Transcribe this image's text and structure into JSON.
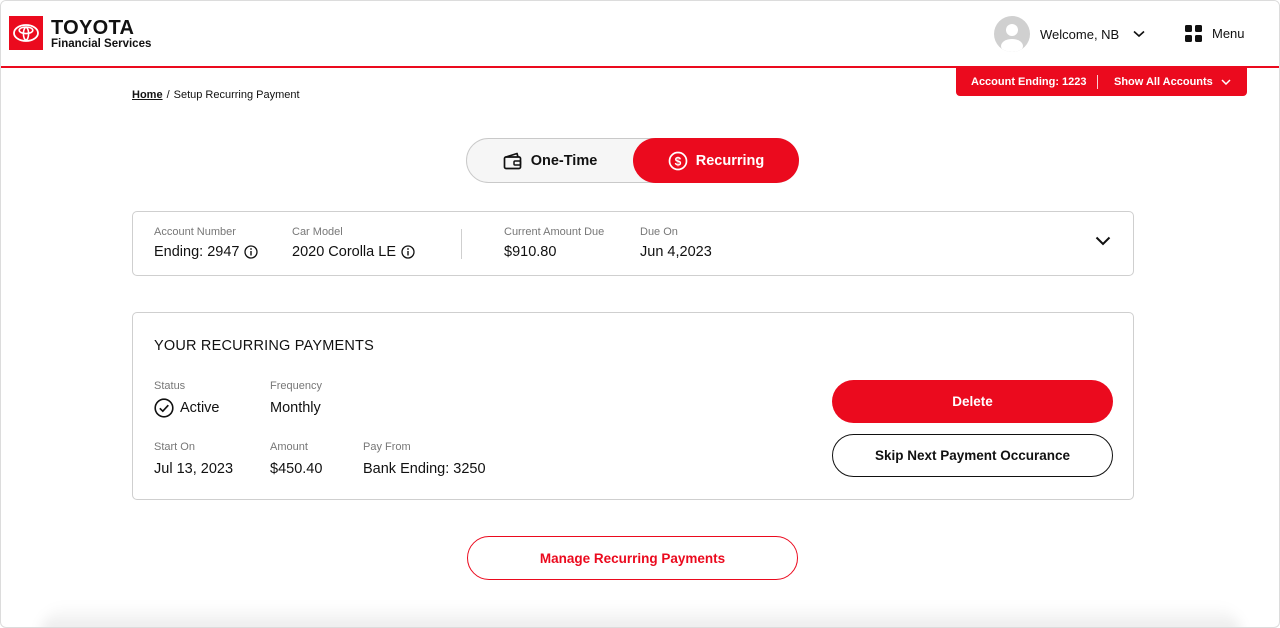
{
  "header": {
    "brand_name": "TOYOTA",
    "brand_sub": "Financial Services",
    "welcome": "Welcome, NB",
    "menu_label": "Menu"
  },
  "account_bar": {
    "ending": "Account Ending: 1223",
    "show_all": "Show All Accounts"
  },
  "breadcrumb": {
    "home": "Home",
    "separator": "/",
    "current": "Setup Recurring Payment"
  },
  "toggle": {
    "one_time": "One-Time",
    "recurring": "Recurring",
    "selected": "Recurring"
  },
  "account_info": {
    "account_number_label": "Account Number",
    "account_number_value": "Ending: 2947",
    "car_model_label": "Car Model",
    "car_model_value": "2020 Corolla LE",
    "amount_due_label": "Current Amount Due",
    "amount_due_value": "$910.80",
    "due_on_label": "Due On",
    "due_on_value": "Jun 4,2023"
  },
  "recurring": {
    "title": "YOUR RECURRING PAYMENTS",
    "status_label": "Status",
    "status_value": "Active",
    "frequency_label": "Frequency",
    "frequency_value": "Monthly",
    "start_label": "Start On",
    "start_value": "Jul 13, 2023",
    "amount_label": "Amount",
    "amount_value": "$450.40",
    "pay_from_label": "Pay From",
    "pay_from_value": "Bank Ending: 3250",
    "delete_label": "Delete",
    "skip_label": "Skip Next Payment Occurance"
  },
  "manage_label": "Manage Recurring Payments",
  "colors": {
    "brand_red": "#eb0a1e",
    "text": "#111111",
    "muted": "#777777",
    "border": "#cfcfcf"
  },
  "icons": {
    "logo": "toyota-logo",
    "avatar": "user-avatar",
    "welcome_chevron": "chevron-down-icon",
    "menu": "grid-icon",
    "one_time": "wallet-icon",
    "recurring": "dollar-circle-icon",
    "info": "info-icon",
    "status": "check-circle-icon"
  }
}
